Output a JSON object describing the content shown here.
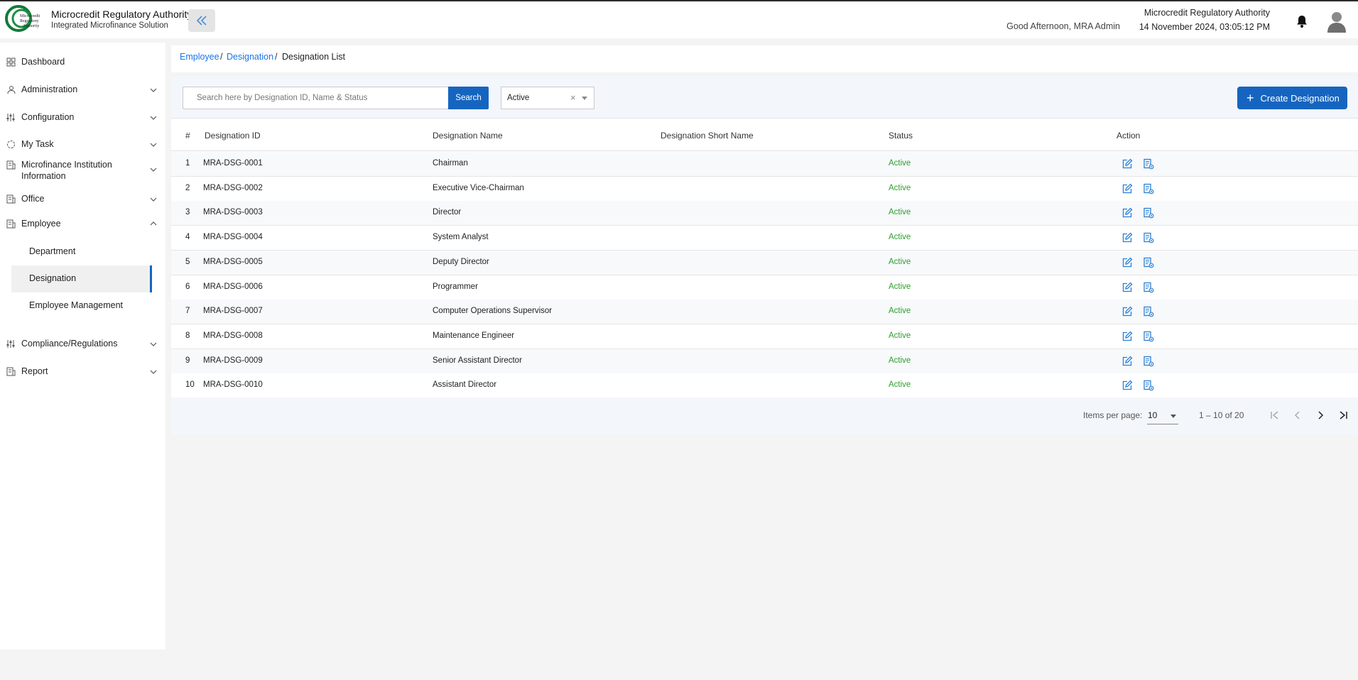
{
  "header": {
    "brand_title": "Microcredit Regulatory Authority",
    "brand_subtitle": "Integrated Microfinance Solution",
    "logo_text": "Microcredit Regulatory Authority",
    "greeting": "Good Afternoon, MRA Admin",
    "org_name": "Microcredit Regulatory Authority",
    "datetime": "14 November 2024, 03:05:12 PM"
  },
  "sidebar": {
    "items": [
      {
        "label": "Dashboard",
        "icon": "dashboard-icon"
      },
      {
        "label": "Administration",
        "icon": "admin-icon"
      },
      {
        "label": "Configuration",
        "icon": "sliders-icon"
      },
      {
        "label": "My Task",
        "icon": "task-icon"
      },
      {
        "label": "Microfinance Institution Information",
        "icon": "building-icon"
      },
      {
        "label": "Office",
        "icon": "office-icon"
      },
      {
        "label": "Employee",
        "icon": "employee-icon"
      },
      {
        "label": "Compliance/Regulations",
        "icon": "sliders-icon"
      },
      {
        "label": "Report",
        "icon": "report-icon"
      }
    ],
    "employee_sub": [
      {
        "label": "Department"
      },
      {
        "label": "Designation"
      },
      {
        "label": "Employee Management"
      }
    ]
  },
  "breadcrumb": {
    "level1": "Employee",
    "level2": "Designation",
    "current": "Designation List",
    "separator": "/"
  },
  "toolbar": {
    "search_placeholder": "Search here by Designation ID, Name & Status",
    "search_label": "Search",
    "status_value": "Active",
    "clear_symbol": "×",
    "create_label": "Create Designation"
  },
  "table": {
    "headers": [
      "#",
      "Designation ID",
      "Designation Name",
      "Designation Short Name",
      "Status",
      "Action"
    ],
    "rows": [
      {
        "n": "1",
        "id": "MRA-DSG-0001",
        "name": "Chairman",
        "short": "",
        "status": "Active"
      },
      {
        "n": "2",
        "id": "MRA-DSG-0002",
        "name": "Executive Vice-Chairman",
        "short": "",
        "status": "Active"
      },
      {
        "n": "3",
        "id": "MRA-DSG-0003",
        "name": "Director",
        "short": "",
        "status": "Active"
      },
      {
        "n": "4",
        "id": "MRA-DSG-0004",
        "name": "System Analyst",
        "short": "",
        "status": "Active"
      },
      {
        "n": "5",
        "id": "MRA-DSG-0005",
        "name": "Deputy Director",
        "short": "",
        "status": "Active"
      },
      {
        "n": "6",
        "id": "MRA-DSG-0006",
        "name": "Programmer",
        "short": "",
        "status": "Active"
      },
      {
        "n": "7",
        "id": "MRA-DSG-0007",
        "name": "Computer Operations Supervisor",
        "short": "",
        "status": "Active"
      },
      {
        "n": "8",
        "id": "MRA-DSG-0008",
        "name": "Maintenance Engineer",
        "short": "",
        "status": "Active"
      },
      {
        "n": "9",
        "id": "MRA-DSG-0009",
        "name": "Senior Assistant Director",
        "short": "",
        "status": "Active"
      },
      {
        "n": "10",
        "id": "MRA-DSG-0010",
        "name": "Assistant Director",
        "short": "",
        "status": "Active"
      }
    ]
  },
  "pagination": {
    "items_per_page_label": "Items per page:",
    "items_per_page": "10",
    "range": "1 – 10 of 20"
  },
  "colors": {
    "primary": "#1565c0",
    "link": "#1a73e8",
    "status_active": "#2e9e2e",
    "icon_blue": "#2a7fd4"
  }
}
